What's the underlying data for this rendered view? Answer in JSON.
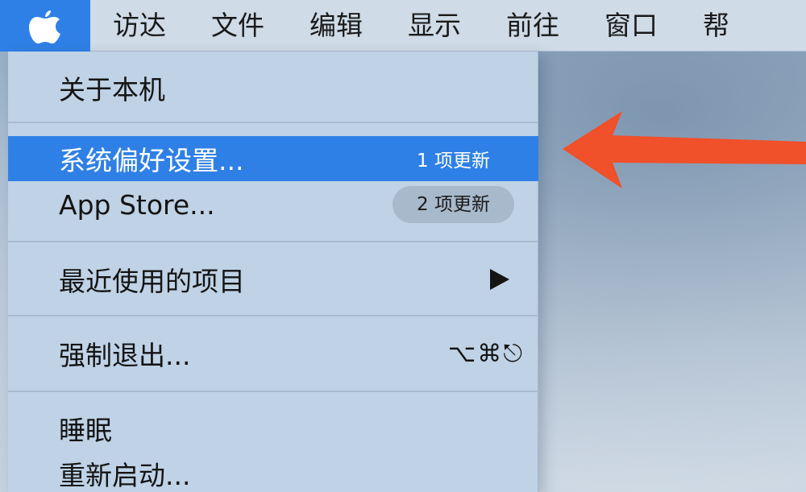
{
  "menubar": {
    "apple_icon": "apple-logo-icon",
    "items": [
      "访达",
      "文件",
      "编辑",
      "显示",
      "前往",
      "窗口",
      "帮"
    ]
  },
  "apple_menu": {
    "about": "关于本机",
    "system_prefs": {
      "label": "系统偏好设置...",
      "badge": "1 项更新"
    },
    "app_store": {
      "label": "App Store...",
      "badge": "2 项更新"
    },
    "recent_items": {
      "label": "最近使用的项目",
      "icon": "submenu-arrow-icon"
    },
    "force_quit": {
      "label": "强制退出...",
      "shortcut": "⌥⌘⎋"
    },
    "sleep": "睡眠",
    "restart": "重新启动..."
  },
  "annotation": {
    "color": "#f0502a",
    "icon": "red-arrow-pointer"
  },
  "colors": {
    "highlight": "#2f80e6",
    "menu_bg": "#bfd2e6",
    "menubar_bg": "#cfdbe7"
  }
}
